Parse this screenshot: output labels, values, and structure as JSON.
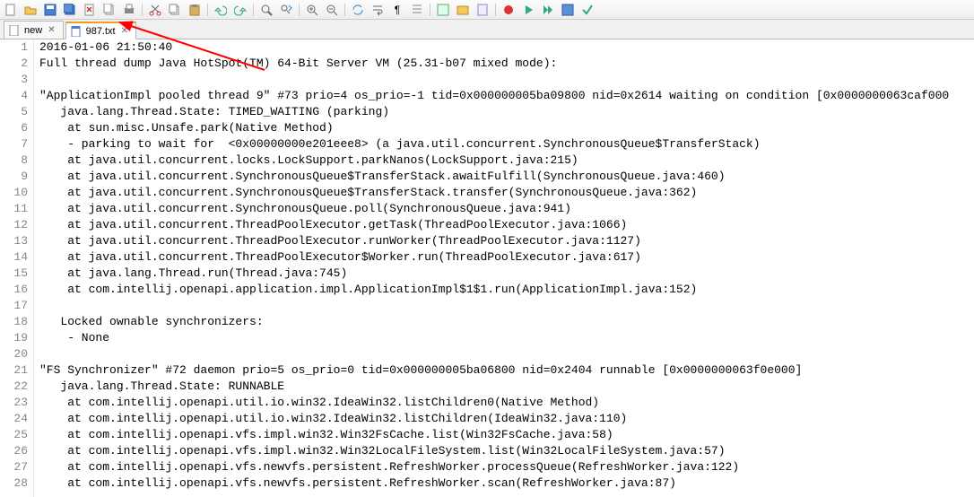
{
  "tabs": [
    {
      "label": "new",
      "active": false
    },
    {
      "label": "987.txt",
      "active": true
    }
  ],
  "lines": [
    "2016-01-06 21:50:40",
    "Full thread dump Java HotSpot(TM) 64-Bit Server VM (25.31-b07 mixed mode):",
    "",
    "\"ApplicationImpl pooled thread 9\" #73 prio=4 os_prio=-1 tid=0x000000005ba09800 nid=0x2614 waiting on condition [0x0000000063caf000",
    "   java.lang.Thread.State: TIMED_WAITING (parking)",
    "    at sun.misc.Unsafe.park(Native Method)",
    "    - parking to wait for  <0x00000000e201eee8> (a java.util.concurrent.SynchronousQueue$TransferStack)",
    "    at java.util.concurrent.locks.LockSupport.parkNanos(LockSupport.java:215)",
    "    at java.util.concurrent.SynchronousQueue$TransferStack.awaitFulfill(SynchronousQueue.java:460)",
    "    at java.util.concurrent.SynchronousQueue$TransferStack.transfer(SynchronousQueue.java:362)",
    "    at java.util.concurrent.SynchronousQueue.poll(SynchronousQueue.java:941)",
    "    at java.util.concurrent.ThreadPoolExecutor.getTask(ThreadPoolExecutor.java:1066)",
    "    at java.util.concurrent.ThreadPoolExecutor.runWorker(ThreadPoolExecutor.java:1127)",
    "    at java.util.concurrent.ThreadPoolExecutor$Worker.run(ThreadPoolExecutor.java:617)",
    "    at java.lang.Thread.run(Thread.java:745)",
    "    at com.intellij.openapi.application.impl.ApplicationImpl$1$1.run(ApplicationImpl.java:152)",
    "",
    "   Locked ownable synchronizers:",
    "    - None",
    "",
    "\"FS Synchronizer\" #72 daemon prio=5 os_prio=0 tid=0x000000005ba06800 nid=0x2404 runnable [0x0000000063f0e000]",
    "   java.lang.Thread.State: RUNNABLE",
    "    at com.intellij.openapi.util.io.win32.IdeaWin32.listChildren0(Native Method)",
    "    at com.intellij.openapi.util.io.win32.IdeaWin32.listChildren(IdeaWin32.java:110)",
    "    at com.intellij.openapi.vfs.impl.win32.Win32FsCache.list(Win32FsCache.java:58)",
    "    at com.intellij.openapi.vfs.impl.win32.Win32LocalFileSystem.list(Win32LocalFileSystem.java:57)",
    "    at com.intellij.openapi.vfs.newvfs.persistent.RefreshWorker.processQueue(RefreshWorker.java:122)",
    "    at com.intellij.openapi.vfs.newvfs.persistent.RefreshWorker.scan(RefreshWorker.java:87)"
  ],
  "toolbar_icons": [
    "new-icon",
    "open-icon",
    "save-icon",
    "save-all-icon",
    "close-icon",
    "print-icon",
    "cut-icon",
    "copy-icon",
    "paste-icon",
    "undo-icon",
    "redo-icon",
    "find-icon",
    "replace-icon",
    "zoom-in-icon",
    "zoom-out-icon",
    "sync-icon",
    "wrap-icon",
    "show-all-icon",
    "indent-icon",
    "fold-icon",
    "unfold-icon",
    "comment-icon",
    "macro-record-icon",
    "macro-play-icon",
    "macro-run-icon"
  ],
  "annotation_color": "#ff0000"
}
